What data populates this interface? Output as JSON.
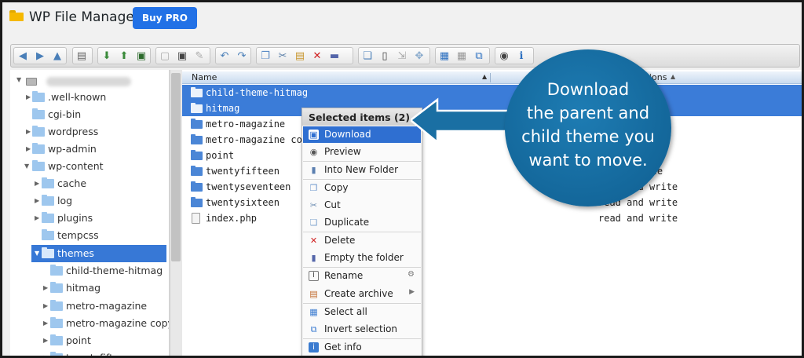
{
  "header": {
    "title": "WP File Manager",
    "buy_pro_label": "Buy PRO"
  },
  "icons": {
    "app": "folder-icon",
    "toolbar": [
      "back-icon",
      "forward-icon",
      "up-icon",
      "home-icon",
      "open-icon",
      "download-icon",
      "upload-icon",
      "new-folder-icon",
      "new-file-icon",
      "save-icon",
      "paste-icon",
      "undo-icon",
      "redo-icon",
      "copy-icon",
      "cut-icon",
      "paste-icon",
      "delete-icon",
      "empty-icon",
      "duplicate-icon",
      "rename-icon",
      "edit-icon",
      "resize-icon",
      "view-icons-icon",
      "view-list-icon",
      "sort-icon",
      "preview-icon",
      "info-icon"
    ]
  },
  "tree": {
    "items": [
      {
        "label": ".well-known"
      },
      {
        "label": "cgi-bin"
      },
      {
        "label": "wordpress"
      },
      {
        "label": "wp-admin"
      },
      {
        "label": "wp-content"
      },
      {
        "label": "cache"
      },
      {
        "label": "log"
      },
      {
        "label": "plugins"
      },
      {
        "label": "tempcss"
      },
      {
        "label": "themes"
      },
      {
        "label": "child-theme-hitmag"
      },
      {
        "label": "hitmag"
      },
      {
        "label": "metro-magazine"
      },
      {
        "label": "metro-magazine copy"
      },
      {
        "label": "point"
      },
      {
        "label": "twentyfifteen"
      }
    ]
  },
  "list": {
    "col_name": "Name",
    "col_perms": "ions",
    "rows": [
      {
        "name": "child-theme-hitmag",
        "perm": "e"
      },
      {
        "name": "hitmag",
        "perm": "e"
      },
      {
        "name": "metro-magazine",
        "perm": ""
      },
      {
        "name": "metro-magazine copy",
        "perm": ""
      },
      {
        "name": "point",
        "perm": "e"
      },
      {
        "name": "twentyfifteen",
        "perm": "write"
      },
      {
        "name": "twentyseventeen",
        "perm": "read and write"
      },
      {
        "name": "twentysixteen",
        "perm": "read and write"
      },
      {
        "name": "index.php",
        "perm": "read and write"
      }
    ]
  },
  "context_menu": {
    "title": "Selected items (2)",
    "items": [
      {
        "label": "Download"
      },
      {
        "label": "Preview"
      },
      {
        "label": "Into New Folder"
      },
      {
        "label": "Copy"
      },
      {
        "label": "Cut"
      },
      {
        "label": "Duplicate"
      },
      {
        "label": "Delete"
      },
      {
        "label": "Empty the folder"
      },
      {
        "label": "Rename"
      },
      {
        "label": "Create archive"
      },
      {
        "label": "Select all"
      },
      {
        "label": "Invert selection"
      },
      {
        "label": "Get info"
      }
    ]
  },
  "callout": {
    "line1": "Download",
    "line2": "the parent and",
    "line3": "child theme you",
    "line4": "want to move."
  },
  "colors": {
    "accent": "#2271e6",
    "selection": "#3b7cd8",
    "callout": "#1a6fa3"
  }
}
